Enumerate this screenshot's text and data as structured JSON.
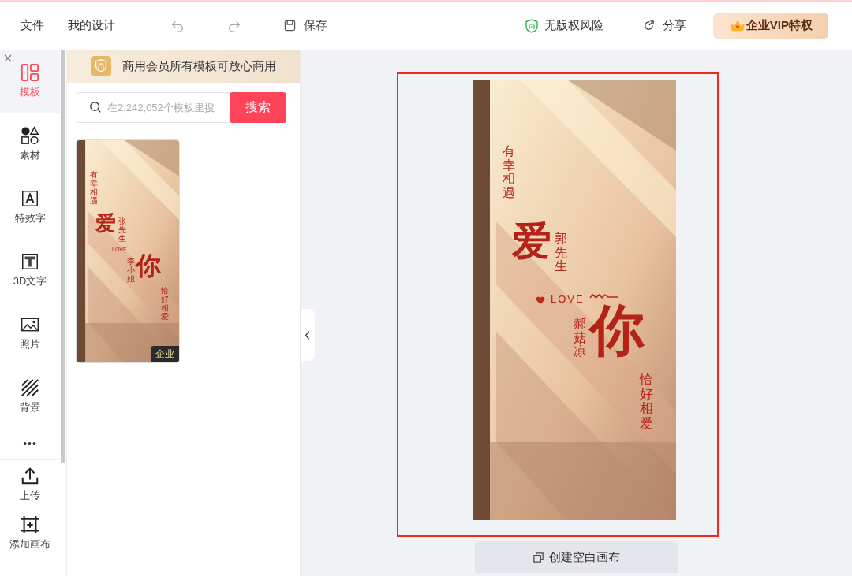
{
  "toolbar": {
    "menu": [
      {
        "label": "文件"
      },
      {
        "label": "我的设计"
      }
    ],
    "save": "保存",
    "copyright": "无版权风险",
    "share": "分享",
    "vip": "企业VIP特权"
  },
  "rail": {
    "items": [
      {
        "label": "模板",
        "selected": true
      },
      {
        "label": "素材",
        "selected": false
      },
      {
        "label": "特效字",
        "selected": false
      },
      {
        "label": "3D文字",
        "selected": false
      },
      {
        "label": "照片",
        "selected": false
      },
      {
        "label": "背景",
        "selected": false
      }
    ],
    "more": "•••",
    "bottom": [
      {
        "label": "上传"
      },
      {
        "label": "添加画布"
      }
    ]
  },
  "panel": {
    "banner": "商用会员所有模板可放心商用",
    "search": {
      "placeholder": "在2,242,052个模板里搜",
      "button": "搜索"
    },
    "templates": [
      {
        "badge": "企业",
        "line_1": "有幸相遇",
        "big_1": "爱",
        "name_1": "张先生",
        "love": "LOVE",
        "big_2": "你",
        "name_2": "李小姐",
        "line_2": "恰好相爱"
      }
    ]
  },
  "canvas": {
    "selected": true,
    "poster": {
      "line_1": "有幸相遇",
      "big_1": "爱",
      "name_1": "郭先生",
      "love": "LOVE",
      "big_2": "你",
      "name_2": "郝菇凉",
      "line_2": "恰好相爱"
    },
    "create": "创建空白画布"
  }
}
